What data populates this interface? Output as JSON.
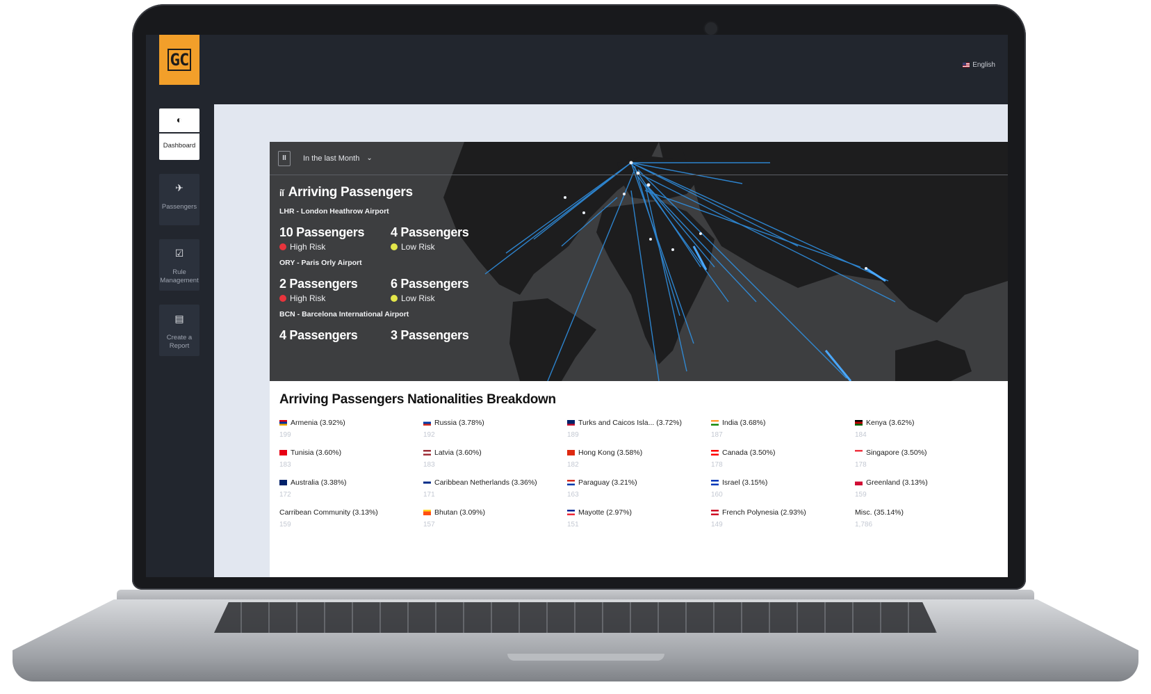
{
  "header": {
    "language": "English",
    "logo_text": "GC"
  },
  "sidebar": {
    "items": [
      {
        "label": "Dashboard",
        "icon": "pie-chart-icon",
        "glyph": "◐",
        "active": true
      },
      {
        "label": "Passengers",
        "icon": "plane-arrival-icon",
        "glyph": "✈",
        "active": false
      },
      {
        "label": "Rule Management",
        "icon": "checkbox-icon",
        "glyph": "☑",
        "active": false
      },
      {
        "label": "Create a Report",
        "icon": "document-icon",
        "glyph": "▤",
        "active": false
      }
    ]
  },
  "map": {
    "pause_label": "II",
    "period": "In the last Month",
    "arrivals_title": "Arriving Passengers",
    "airports": [
      {
        "name": "LHR - London Heathrow Airport",
        "high": {
          "count": "10 Passengers",
          "risk": "High Risk"
        },
        "low": {
          "count": "4 Passengers",
          "risk": "Low Risk"
        }
      },
      {
        "name": "ORY - Paris Orly Airport",
        "high": {
          "count": "2 Passengers",
          "risk": "High Risk"
        },
        "low": {
          "count": "6 Passengers",
          "risk": "Low Risk"
        }
      },
      {
        "name": "BCN - Barcelona International Airport",
        "high": {
          "count": "4 Passengers",
          "risk": ""
        },
        "low": {
          "count": "3 Passengers",
          "risk": ""
        }
      }
    ],
    "colors": {
      "land": "#1d1d1e",
      "sea": "#3d3e40",
      "route": "#2f8fe0",
      "high": "#e8343c",
      "low": "#e3e64a"
    }
  },
  "breakdown": {
    "title": "Arriving Passengers Nationalities Breakdown",
    "rows": [
      [
        {
          "label": "Armenia (3.92%)",
          "count": "199",
          "flag": [
            "#d90012",
            "#0033a0",
            "#f2a800"
          ]
        },
        {
          "label": "Russia (3.78%)",
          "count": "192",
          "flag": [
            "#ffffff",
            "#0039a6",
            "#d52b1e"
          ]
        },
        {
          "label": "Turks and Caicos Isla... (3.72%)",
          "count": "189",
          "flag": [
            "#012169",
            "#012169",
            "#c8102e"
          ]
        },
        {
          "label": "India (3.68%)",
          "count": "187",
          "flag": [
            "#ff9933",
            "#ffffff",
            "#138808"
          ]
        },
        {
          "label": "Kenya (3.62%)",
          "count": "184",
          "flag": [
            "#000000",
            "#bb0000",
            "#006600"
          ]
        }
      ],
      [
        {
          "label": "Tunisia (3.60%)",
          "count": "183",
          "flag": [
            "#e70013",
            "#e70013",
            "#e70013"
          ]
        },
        {
          "label": "Latvia (3.60%)",
          "count": "183",
          "flag": [
            "#9e3039",
            "#ffffff",
            "#9e3039"
          ]
        },
        {
          "label": "Hong Kong (3.58%)",
          "count": "182",
          "flag": [
            "#de2910",
            "#de2910",
            "#de2910"
          ]
        },
        {
          "label": "Canada (3.50%)",
          "count": "178",
          "flag": [
            "#ff0000",
            "#ffffff",
            "#ff0000"
          ]
        },
        {
          "label": "Singapore (3.50%)",
          "count": "178",
          "flag": [
            "#ef3340",
            "#ffffff",
            "#ffffff"
          ]
        }
      ],
      [
        {
          "label": "Australia (3.38%)",
          "count": "172",
          "flag": [
            "#012169",
            "#012169",
            "#012169"
          ]
        },
        {
          "label": "Caribbean Netherlands (3.36%)",
          "count": "171",
          "flag": [
            "#ffffff",
            "#012a87",
            "#ffffff"
          ]
        },
        {
          "label": "Paraguay (3.21%)",
          "count": "163",
          "flag": [
            "#d52b1e",
            "#ffffff",
            "#0038a8"
          ]
        },
        {
          "label": "Israel (3.15%)",
          "count": "160",
          "flag": [
            "#0038b8",
            "#ffffff",
            "#0038b8"
          ]
        },
        {
          "label": "Greenland (3.13%)",
          "count": "159",
          "flag": [
            "#ffffff",
            "#d00c33",
            "#d00c33"
          ]
        }
      ],
      [
        {
          "label": "Carribean Community (3.13%)",
          "count": "159",
          "flag": []
        },
        {
          "label": "Bhutan (3.09%)",
          "count": "157",
          "flag": [
            "#ffd520",
            "#ff4e12",
            "#ff4e12"
          ]
        },
        {
          "label": "Mayotte (2.97%)",
          "count": "151",
          "flag": [
            "#002395",
            "#ffffff",
            "#ed2939"
          ]
        },
        {
          "label": "French Polynesia (2.93%)",
          "count": "149",
          "flag": [
            "#ce1126",
            "#ffffff",
            "#ce1126"
          ]
        },
        {
          "label": "Misc. (35.14%)",
          "count": "1,786",
          "flag": []
        }
      ]
    ]
  }
}
